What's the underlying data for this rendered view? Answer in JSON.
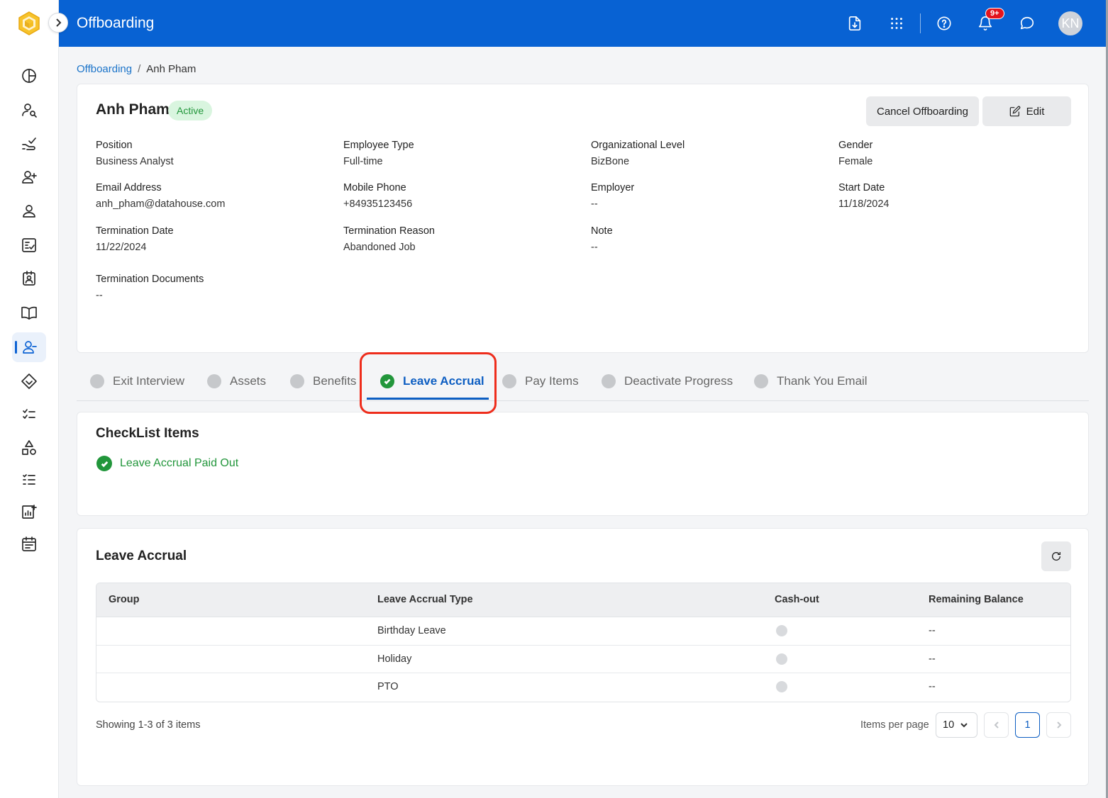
{
  "header": {
    "title": "Offboarding",
    "notification_badge": "9+",
    "avatar_initials": "KN"
  },
  "breadcrumb": {
    "parent": "Offboarding",
    "separator": "/",
    "current": "Anh Pham"
  },
  "profile": {
    "name": "Anh Pham",
    "status": "Active",
    "cancel_label": "Cancel Offboarding",
    "edit_label": "Edit",
    "fields": [
      {
        "label": "Position",
        "value": "Business Analyst"
      },
      {
        "label": "Employee Type",
        "value": "Full-time"
      },
      {
        "label": "Organizational Level",
        "value": "BizBone"
      },
      {
        "label": "Gender",
        "value": "Female"
      },
      {
        "label": "Email Address",
        "value": "anh_pham@datahouse.com"
      },
      {
        "label": "Mobile Phone",
        "value": "+84935123456"
      },
      {
        "label": "Employer",
        "value": "--"
      },
      {
        "label": "Start Date",
        "value": "11/18/2024"
      },
      {
        "label": "Termination Date",
        "value": "11/22/2024"
      },
      {
        "label": "Termination Reason",
        "value": "Abandoned Job"
      },
      {
        "label": "Note",
        "value": "--"
      },
      {
        "label": "Termination Documents",
        "value": "--"
      }
    ]
  },
  "tabs": [
    {
      "label": "Exit Interview",
      "completed": false
    },
    {
      "label": "Assets",
      "completed": false
    },
    {
      "label": "Benefits",
      "completed": false
    },
    {
      "label": "Leave Accrual",
      "completed": true,
      "active": true
    },
    {
      "label": "Pay Items",
      "completed": false
    },
    {
      "label": "Deactivate Progress",
      "completed": false
    },
    {
      "label": "Thank You Email",
      "completed": false
    }
  ],
  "checklist": {
    "title": "CheckList Items",
    "items": [
      {
        "label": "Leave Accrual Paid Out",
        "done": true
      }
    ]
  },
  "leave_accrual": {
    "title": "Leave Accrual",
    "columns": [
      "Group",
      "Leave Accrual Type",
      "Cash-out",
      "Remaining Balance"
    ],
    "rows": [
      {
        "group": "",
        "type": "Birthday Leave",
        "cash_out": false,
        "balance": "--"
      },
      {
        "group": "",
        "type": "Holiday",
        "cash_out": false,
        "balance": "--"
      },
      {
        "group": "",
        "type": "PTO",
        "cash_out": false,
        "balance": "--"
      }
    ],
    "showing": "Showing 1-3 of 3 items",
    "items_per_page_label": "Items per page",
    "items_per_page": "10",
    "current_page": "1"
  },
  "colors": {
    "primary": "#0862d3",
    "success": "#22963b",
    "highlight": "#ee2d1c"
  },
  "icons": {
    "sidebar": [
      "dashboard-icon",
      "user-search-icon",
      "onboarding-icon",
      "add-user-icon",
      "user-icon",
      "checklist-board-icon",
      "contact-card-icon",
      "handbook-icon",
      "offboarding-icon",
      "tag-icon",
      "task-list-icon",
      "shapes-icon",
      "numbered-list-icon",
      "report-icon",
      "calendar-icon"
    ],
    "header": [
      "download-doc-icon",
      "apps-grid-icon",
      "help-icon",
      "bell-icon",
      "chat-icon"
    ]
  }
}
